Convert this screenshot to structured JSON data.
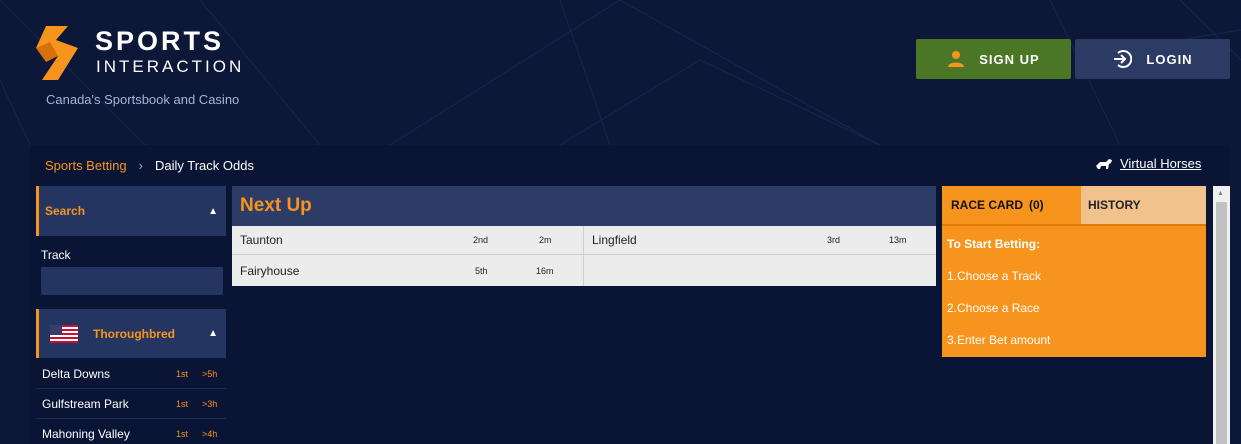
{
  "brand": {
    "name_top": "SPORTS",
    "name_bottom": "INTERACTION",
    "tagline": "Canada's Sportsbook and Casino"
  },
  "header": {
    "signup_label": "SIGN UP",
    "login_label": "LOGIN"
  },
  "breadcrumb": {
    "root": "Sports Betting",
    "current": "Daily Track Odds"
  },
  "virtual_link": "Virtual Horses",
  "sidebar": {
    "search_label": "Search",
    "track_label": "Track",
    "track_value": "",
    "section_label": "Thoroughbred",
    "races": [
      {
        "name": "Delta Downs",
        "pos": "1st",
        "time": ">5h"
      },
      {
        "name": "Gulfstream Park",
        "pos": "1st",
        "time": ">3h"
      },
      {
        "name": "Mahoning Valley",
        "pos": "1st",
        "time": ">4h"
      }
    ]
  },
  "next_up": {
    "title": "Next Up",
    "entries": [
      {
        "name": "Taunton",
        "pos": "2nd",
        "time": "2m"
      },
      {
        "name": "Lingfield",
        "pos": "3rd",
        "time": "13m"
      },
      {
        "name": "Fairyhouse",
        "pos": "5th",
        "time": "16m"
      }
    ]
  },
  "race_card": {
    "tab_label": "RACE CARD",
    "count": "(0)",
    "history_label": "HISTORY",
    "instructions_title": "To Start Betting:",
    "steps": [
      "1.Choose a Track",
      "2.Choose a Race",
      "3.Enter Bet amount"
    ]
  },
  "colors": {
    "background": "#0d1738",
    "accent": "#f7941d",
    "signup": "#4b7625",
    "login": "#2c3b63"
  }
}
